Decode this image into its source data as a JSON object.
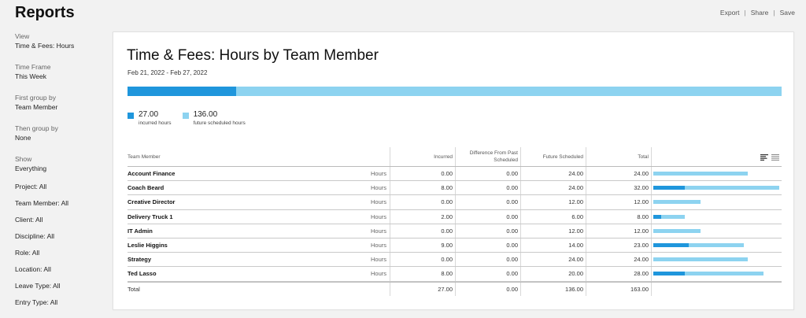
{
  "app": {
    "title": "Reports"
  },
  "actions": {
    "export": "Export",
    "share": "Share",
    "save": "Save",
    "separator": "|"
  },
  "sidebar": {
    "groups": [
      {
        "label": "View",
        "value": "Time & Fees: Hours"
      },
      {
        "label": "Time Frame",
        "value": "This Week"
      },
      {
        "label": "First group by",
        "value": "Team Member"
      },
      {
        "label": "Then group by",
        "value": "None"
      },
      {
        "label": "Show",
        "value": "Everything"
      }
    ],
    "filters": [
      "Project: All",
      "Team Member: All",
      "Client: All",
      "Discipline: All",
      "Role: All",
      "Location: All",
      "Leave Type: All",
      "Entry Type: All"
    ]
  },
  "report": {
    "title": "Time & Fees: Hours by Team Member",
    "date_range": "Feb 21, 2022 - Feb 27, 2022",
    "incurred_total": 27.0,
    "future_total": 136.0,
    "legend": {
      "incurred_value": "27.00",
      "incurred_label": "incurred hours",
      "future_value": "136.00",
      "future_label": "future scheduled hours"
    },
    "colors": {
      "incurred": "#1f96dc",
      "future": "#8dd3f0"
    },
    "bar_max": 32,
    "columns": {
      "name": "Team Member",
      "incurred": "Incurred",
      "diff": "Difference From Past Scheduled",
      "future": "Future Scheduled",
      "total": "Total"
    },
    "unit_label": "Hours",
    "rows": [
      {
        "name": "Account Finance",
        "incurred": "0.00",
        "diff": "0.00",
        "future": "24.00",
        "total": "24.00",
        "inc_v": 0,
        "fut_v": 24
      },
      {
        "name": "Coach Beard",
        "incurred": "8.00",
        "diff": "0.00",
        "future": "24.00",
        "total": "32.00",
        "inc_v": 8,
        "fut_v": 24
      },
      {
        "name": "Creative Director",
        "incurred": "0.00",
        "diff": "0.00",
        "future": "12.00",
        "total": "12.00",
        "inc_v": 0,
        "fut_v": 12
      },
      {
        "name": "Delivery Truck 1",
        "incurred": "2.00",
        "diff": "0.00",
        "future": "6.00",
        "total": "8.00",
        "inc_v": 2,
        "fut_v": 6
      },
      {
        "name": "IT Admin",
        "incurred": "0.00",
        "diff": "0.00",
        "future": "12.00",
        "total": "12.00",
        "inc_v": 0,
        "fut_v": 12
      },
      {
        "name": "Leslie Higgins",
        "incurred": "9.00",
        "diff": "0.00",
        "future": "14.00",
        "total": "23.00",
        "inc_v": 9,
        "fut_v": 14
      },
      {
        "name": "Strategy",
        "incurred": "0.00",
        "diff": "0.00",
        "future": "24.00",
        "total": "24.00",
        "inc_v": 0,
        "fut_v": 24
      },
      {
        "name": "Ted Lasso",
        "incurred": "8.00",
        "diff": "0.00",
        "future": "20.00",
        "total": "28.00",
        "inc_v": 8,
        "fut_v": 20
      }
    ],
    "total_row": {
      "name": "Total",
      "incurred": "27.00",
      "diff": "0.00",
      "future": "136.00",
      "total": "163.00"
    },
    "view_icons": [
      "bar-view-icon",
      "list-view-icon"
    ]
  }
}
